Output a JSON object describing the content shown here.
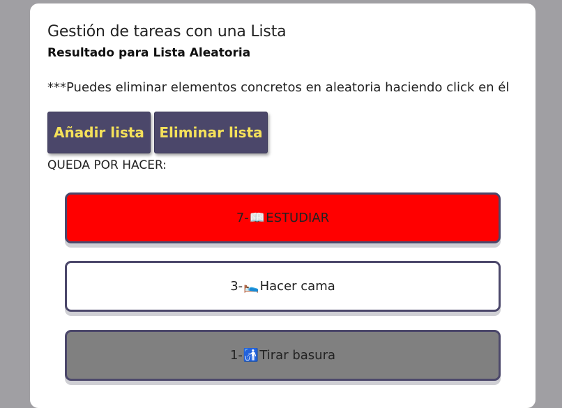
{
  "header": {
    "title": "Gestión de tareas con una Lista",
    "subtitle": "Resultado para Lista Aleatoria"
  },
  "hint": "***Puedes eliminar elementos concretos en aleatoria haciendo click en él",
  "buttons": {
    "add_label": "Añadir lista",
    "delete_label": "Eliminar lista",
    "text_color": "#f5e15a",
    "bg_color": "#4b476a"
  },
  "section_label": "QUEDA POR HACER:",
  "tasks": [
    {
      "number": "7-",
      "icon": "📖",
      "icon_name": "open-book-icon",
      "text": "ESTUDIAR",
      "bg": "#ff0000"
    },
    {
      "number": "3-",
      "icon": "🛌",
      "icon_name": "bed-icon",
      "text": "Hacer cama",
      "bg": "#ffffff"
    },
    {
      "number": "1-",
      "icon": "🚮",
      "icon_name": "trash-bin-icon",
      "text": "Tirar basura",
      "bg": "#808080"
    }
  ]
}
